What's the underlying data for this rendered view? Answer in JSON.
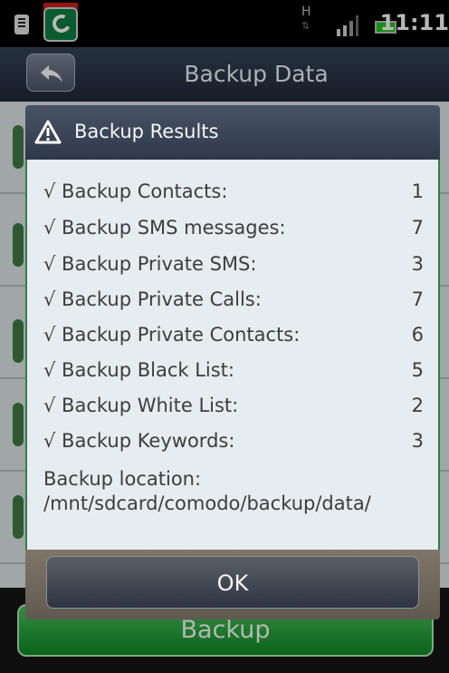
{
  "status_bar": {
    "network": "H",
    "time": "11:11"
  },
  "header": {
    "title": "Backup Data"
  },
  "dialog": {
    "title": "Backup Results",
    "items": [
      {
        "label": "√ Backup Contacts:",
        "value": "1"
      },
      {
        "label": "√ Backup SMS messages:",
        "value": "7"
      },
      {
        "label": "√ Backup Private SMS:",
        "value": "3"
      },
      {
        "label": "√ Backup Private Calls:",
        "value": "7"
      },
      {
        "label": "√ Backup Private Contacts:",
        "value": "6"
      },
      {
        "label": "√ Backup Black List:",
        "value": "5"
      },
      {
        "label": "√ Backup White List:",
        "value": "2"
      },
      {
        "label": "√ Backup Keywords:",
        "value": "3"
      }
    ],
    "location_label": "Backup location:",
    "location_path": "/mnt/sdcard/comodo/backup/data/",
    "ok_label": "OK"
  },
  "footer": {
    "backup_label": "Backup"
  },
  "icons": {
    "back": "back-arrow-icon",
    "warning": "warning-icon",
    "app": "comodo-app-icon",
    "signal": "signal-icon",
    "battery": "battery-icon"
  },
  "colors": {
    "header": "#2f394b",
    "accent_green": "#2a9a3a",
    "dialog_body": "#e6ecef",
    "dialog_footer": "#6d665b"
  }
}
